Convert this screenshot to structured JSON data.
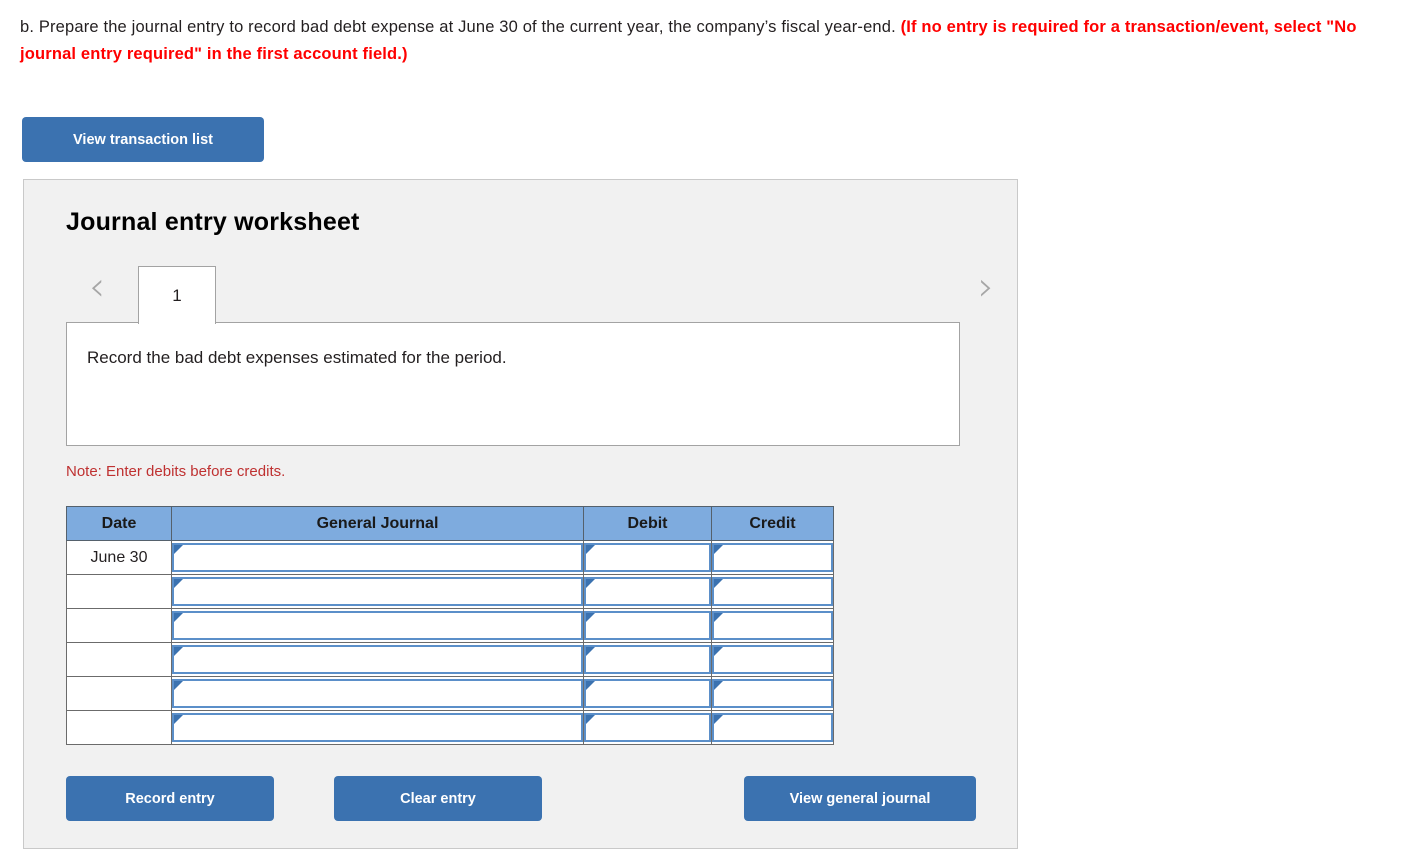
{
  "prompt": {
    "lead": "b. Prepare the journal entry to record bad debt expense at June 30 of the current year, the company’s fiscal year-end. ",
    "warning": "(If no entry is required for a transaction/event, select \"No journal entry required\" in the first account field.)"
  },
  "toolbar": {
    "view_transaction_list": "View transaction list"
  },
  "worksheet": {
    "title": "Journal entry worksheet",
    "prev_icon": "chevron-left-icon",
    "next_icon": "chevron-right-icon",
    "tabs": [
      {
        "label": "1",
        "active": true
      }
    ],
    "description": "Record the bad debt expenses estimated for the period.",
    "note": "Note: Enter debits before credits."
  },
  "table": {
    "columns": [
      "Date",
      "General Journal",
      "Debit",
      "Credit"
    ],
    "rows": [
      {
        "date": "June 30",
        "general_journal": "",
        "debit": "",
        "credit": ""
      },
      {
        "date": "",
        "general_journal": "",
        "debit": "",
        "credit": ""
      },
      {
        "date": "",
        "general_journal": "",
        "debit": "",
        "credit": ""
      },
      {
        "date": "",
        "general_journal": "",
        "debit": "",
        "credit": ""
      },
      {
        "date": "",
        "general_journal": "",
        "debit": "",
        "credit": ""
      },
      {
        "date": "",
        "general_journal": "",
        "debit": "",
        "credit": ""
      }
    ]
  },
  "actions": {
    "record_entry": "Record entry",
    "clear_entry": "Clear entry",
    "view_general_journal": "View general journal"
  },
  "colors": {
    "button_blue": "#3b72b0",
    "header_blue": "#7eabde",
    "warning_red": "#ff0000",
    "note_red": "#bf3131",
    "panel_bg": "#f1f1f1",
    "combo_border": "#5b8fc9"
  }
}
